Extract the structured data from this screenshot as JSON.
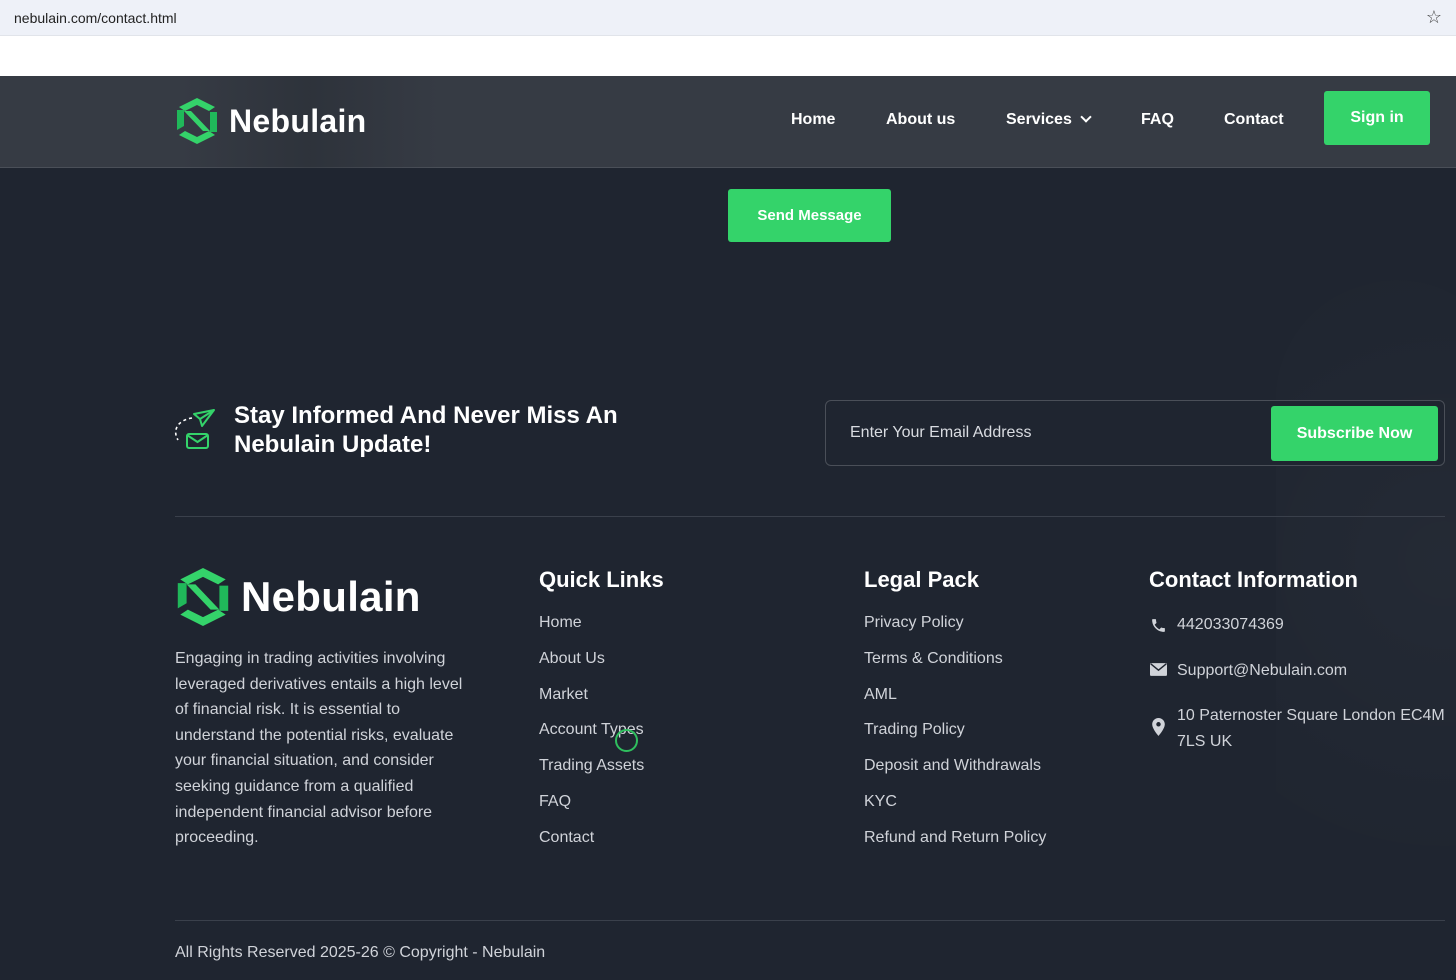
{
  "browser": {
    "url": "nebulain.com/contact.html"
  },
  "brand": {
    "name": "Nebulain",
    "accent": "#34d36a"
  },
  "nav": {
    "items": [
      "Home",
      "About us",
      "Services",
      "FAQ",
      "Contact"
    ],
    "signin_label": "Sign in"
  },
  "form": {
    "send_label": "Send Message"
  },
  "newsletter": {
    "title_line1": "Stay Informed And Never Miss An",
    "title_line2": "Nebulain Update!",
    "placeholder": "Enter Your Email Address",
    "button_label": "Subscribe Now"
  },
  "footer": {
    "about_text": "Engaging in trading activities involving leveraged derivatives entails a high level of financial risk. It is essential to understand the potential risks, evaluate your financial situation, and consider seeking guidance from a qualified independent financial advisor before proceeding.",
    "quick_links": {
      "title": "Quick Links",
      "items": [
        "Home",
        "About Us",
        "Market",
        "Account Types",
        "Trading Assets",
        "FAQ",
        "Contact"
      ]
    },
    "legal": {
      "title": "Legal Pack",
      "items": [
        "Privacy Policy",
        "Terms & Conditions",
        "AML",
        "Trading Policy",
        "Deposit and Withdrawals",
        "KYC",
        "Refund and Return Policy"
      ]
    },
    "contact": {
      "title": "Contact Information",
      "phone": "442033074369",
      "email": "Support@Nebulain.com",
      "address_line1": "10 Paternoster Square London EC4M",
      "address_line2": "7LS UK"
    },
    "copyright": "All Rights Reserved 2025-26 © Copyright - Nebulain"
  }
}
